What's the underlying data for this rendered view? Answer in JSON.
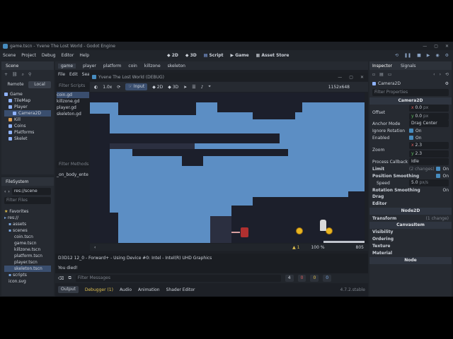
{
  "window": {
    "title": "game.tscn - Yvene The Lost World - Godot Engine"
  },
  "menu": [
    "Scene",
    "Project",
    "Debug",
    "Editor",
    "Help"
  ],
  "main_screens": {
    "b2d": "2D",
    "b3d": "3D",
    "script": "Script",
    "game": "Game",
    "assetlib": "Asset Store"
  },
  "scene_dock": {
    "tab": "Scene",
    "remote": "Remote",
    "local": "Local",
    "filter_placeholder": "Filter: n",
    "nodes": [
      "Game",
      "TileMap",
      "Player",
      "Camera2D",
      "Kill",
      "Coins",
      "Platforms",
      "Skelet"
    ]
  },
  "filesystem_dock": {
    "tab": "FileSystem",
    "path": "res://scene",
    "filter_placeholder": "Filter Files",
    "items": [
      "Favorites",
      "res://",
      "assets",
      "scenes",
      "coin.tscn",
      "game.tscn",
      "killzone.tscn",
      "platform.tscn",
      "player.tscn",
      "skeleton.tscn",
      "scripts",
      "icon.svg"
    ]
  },
  "script_tabs": [
    "game",
    "player",
    "platform",
    "coin",
    "killzone",
    "skeleton"
  ],
  "script_menu": [
    "File",
    "Edit",
    "Sear"
  ],
  "scripts_filter": "Filter Scripts",
  "scripts_list": [
    "coin.gd",
    "killzone.gd",
    "player.gd",
    "skeleton.gd"
  ],
  "methods_filter": "Filter Methods",
  "methods_list": [
    "_on_body_ente"
  ],
  "game_window": {
    "title": "Yvene The Lost World (DEBUG)",
    "resolution": "1152x648",
    "zoom": "1.0x",
    "input": "Input",
    "b2d": "2D",
    "b3d": "3D"
  },
  "editor_status": {
    "warnings": "1",
    "zoom": "100 %",
    "ln": "805"
  },
  "output": {
    "line1": "D3D12 12_0 - Forward+ - Using Device #0: Intel - Intel(R) UHD Graphics",
    "line2": "You died!",
    "filter_placeholder": "Filter Messages",
    "counts": {
      "log": "4",
      "err": "0",
      "warn": "0",
      "info": "0"
    }
  },
  "bottom_tabs": [
    "Output",
    "Debugger (1)",
    "Audio",
    "Animation",
    "Shader Editor"
  ],
  "version": "4.7.2.stable",
  "inspector": {
    "tabs": {
      "inspector": "Inspector",
      "signals": "Signals"
    },
    "object": "Camera2D",
    "filter_placeholder": "Filter Properties",
    "section": "Camera2D",
    "offset_label": "Offset",
    "offset_x": "0.0",
    "offset_y": "0.0",
    "unit": "px",
    "anchor_label": "Anchor Mode",
    "anchor_value": "Drag Center",
    "ignore_rotation": "Ignore Rotation",
    "enabled": "Enabled",
    "on": "On",
    "zoom_label": "Zoom",
    "zoom_x": "2.3",
    "zoom_y": "2.3",
    "process_label": "Process Callback",
    "process_value": "Idle",
    "limit": "Limit",
    "limit_changes": "(2 changes)",
    "pos_smooth": "Position Smoothing",
    "speed_label": "Speed",
    "speed_value": "5.0",
    "speed_unit": "px/s",
    "rot_smooth": "Rotation Smoothing",
    "drag": "Drag",
    "editor": "Editor",
    "node2d": "Node2D",
    "transform": "Transform",
    "transform_changes": "(1 change)",
    "canvasitem": "CanvasItem",
    "visibility": "Visibility",
    "ordering": "Ordering",
    "texture": "Texture",
    "material": "Material",
    "node": "Node"
  }
}
